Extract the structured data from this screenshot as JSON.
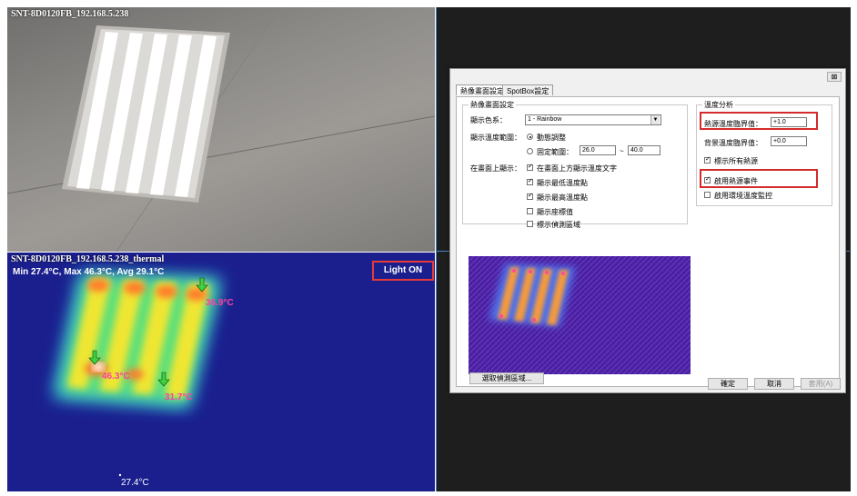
{
  "camera_visible": {
    "title": "SNT-8D0120FB_192.168.5.238"
  },
  "camera_thermal": {
    "title": "SNT-8D0120FB_192.168.5.238_thermal",
    "stats": "Min 27.4°C, Max 46.3°C, Avg 29.1°C",
    "light_label": "Light ON",
    "labels": {
      "t1": "36.9°C",
      "t2": "46.3°C",
      "t3": "31.7°C",
      "t4": "27.4°C"
    }
  },
  "dialog": {
    "close": "⊠",
    "tabs": [
      "熱像畫面設定",
      "SpotBox設定"
    ],
    "left_group": {
      "title": "熱像畫面設定",
      "palette_label": "顯示色系：",
      "palette_value": "1 - Rainbow",
      "range_label": "顯示溫度範圍：",
      "auto_label": "動態調整",
      "fixed_label": "固定範圍：",
      "fixed_min": "26.0",
      "tilde": "~",
      "fixed_max": "40.0",
      "onscreen_label": "在畫面上顯示：",
      "checks": [
        {
          "label": "在畫面上方顯示溫度文字",
          "checked": true
        },
        {
          "label": "顯示最低溫度點",
          "checked": true
        },
        {
          "label": "顯示最高溫度點",
          "checked": true
        },
        {
          "label": "顯示座標值",
          "checked": false
        },
        {
          "label": "標示偵測區域",
          "checked": false
        }
      ]
    },
    "select_area_button": "選取偵測區域...",
    "right_group": {
      "title": "溫度分析",
      "heat_label": "熱源溫度臨界值：",
      "heat_value": "+1.0",
      "bg_label": "背景溫度臨界值：",
      "bg_value": "+0.0",
      "check_all": {
        "label": "標示所有熱源",
        "checked": true
      },
      "check_event": {
        "label": "啟用熱源事件",
        "checked": true
      },
      "check_env": {
        "label": "啟用環境溫度監控",
        "checked": false
      }
    },
    "buttons": {
      "ok": "確定",
      "cancel": "取消",
      "apply": "套用(A)"
    }
  }
}
